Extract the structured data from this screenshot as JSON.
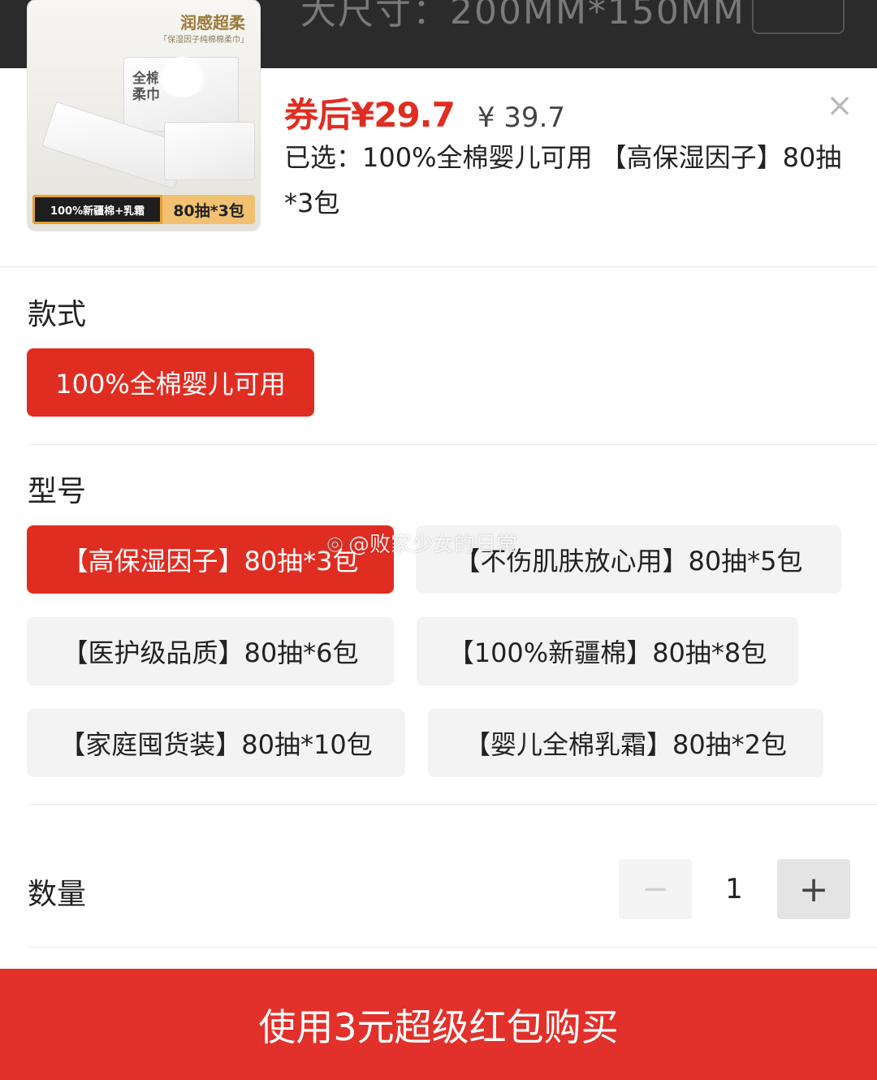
{
  "backdrop": {
    "text": "大尺寸：200MM*150MM"
  },
  "product": {
    "image": {
      "title": "润感超柔",
      "subtitle": "「保湿因子纯棉棉柔巾」",
      "box_text": "全棉柔巾",
      "band_left": "100%新疆棉+乳霜",
      "band_right": "80抽*3包"
    },
    "price_now": "券后¥29.7",
    "price_old": "¥ 39.7",
    "selected_text": "已选：100%全棉婴儿可用 【高保湿因子】80抽*3包"
  },
  "style_section": {
    "title": "款式",
    "options": [
      {
        "label": "100%全棉婴儿可用",
        "active": true
      }
    ]
  },
  "model_section": {
    "title": "型号",
    "options": [
      {
        "label": "【高保湿因子】80抽*3包",
        "active": true
      },
      {
        "label": "【不伤肌肤放心用】80抽*5包",
        "active": false
      },
      {
        "label": "【医护级品质】80抽*6包",
        "active": false
      },
      {
        "label": "【100%新疆棉】80抽*8包",
        "active": false
      },
      {
        "label": "【家庭囤货装】80抽*10包",
        "active": false
      },
      {
        "label": "【婴儿全棉乳霜】80抽*2包",
        "active": false
      }
    ]
  },
  "quantity": {
    "label": "数量",
    "value": "1",
    "minus": "−",
    "plus": "+"
  },
  "buy_button": "使用3元超级红包购买",
  "close_icon": "×",
  "watermark": "@败家少女的日常",
  "colors": {
    "accent": "#e02d22",
    "idle_chip": "#f3f3f3"
  }
}
